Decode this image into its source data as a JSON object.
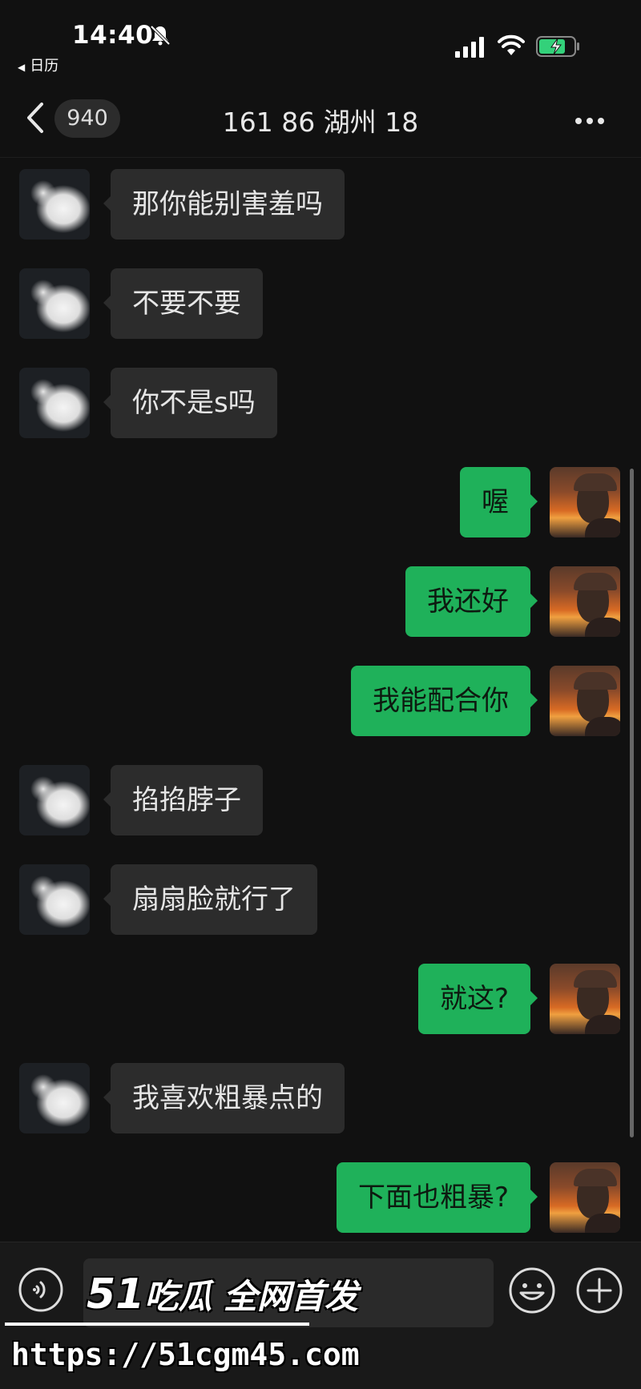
{
  "status_bar": {
    "time": "14:40",
    "back_app": "日历",
    "icons": [
      "bell-mute-icon",
      "signal-icon",
      "wifi-icon",
      "battery-charging-icon"
    ]
  },
  "nav": {
    "unread_count": "940",
    "title": "161 86  湖州 18",
    "icons": [
      "chevron-left-icon",
      "more-icon"
    ]
  },
  "messages": [
    {
      "side": "left",
      "text": "那你能别害羞吗"
    },
    {
      "side": "left",
      "text": "不要不要"
    },
    {
      "side": "left",
      "text": "你不是s吗"
    },
    {
      "side": "right",
      "text": "喔"
    },
    {
      "side": "right",
      "text": "我还好"
    },
    {
      "side": "right",
      "text": "我能配合你"
    },
    {
      "side": "left",
      "text": "掐掐脖子"
    },
    {
      "side": "left",
      "text": "扇扇脸就行了"
    },
    {
      "side": "right",
      "text": "就这?"
    },
    {
      "side": "left",
      "text": "我喜欢粗暴点的"
    },
    {
      "side": "right",
      "text": "下面也粗暴?"
    }
  ],
  "input_bar": {
    "icons": [
      "voice-icon",
      "emoji-icon",
      "plus-icon"
    ],
    "input_value": ""
  },
  "watermark": {
    "number": "51",
    "text": "吃瓜 全网首发",
    "url": "https://51cgm45.com"
  },
  "colors": {
    "background": "#111111",
    "incoming_bubble": "#2c2c2c",
    "outgoing_bubble": "#1fb15a"
  }
}
